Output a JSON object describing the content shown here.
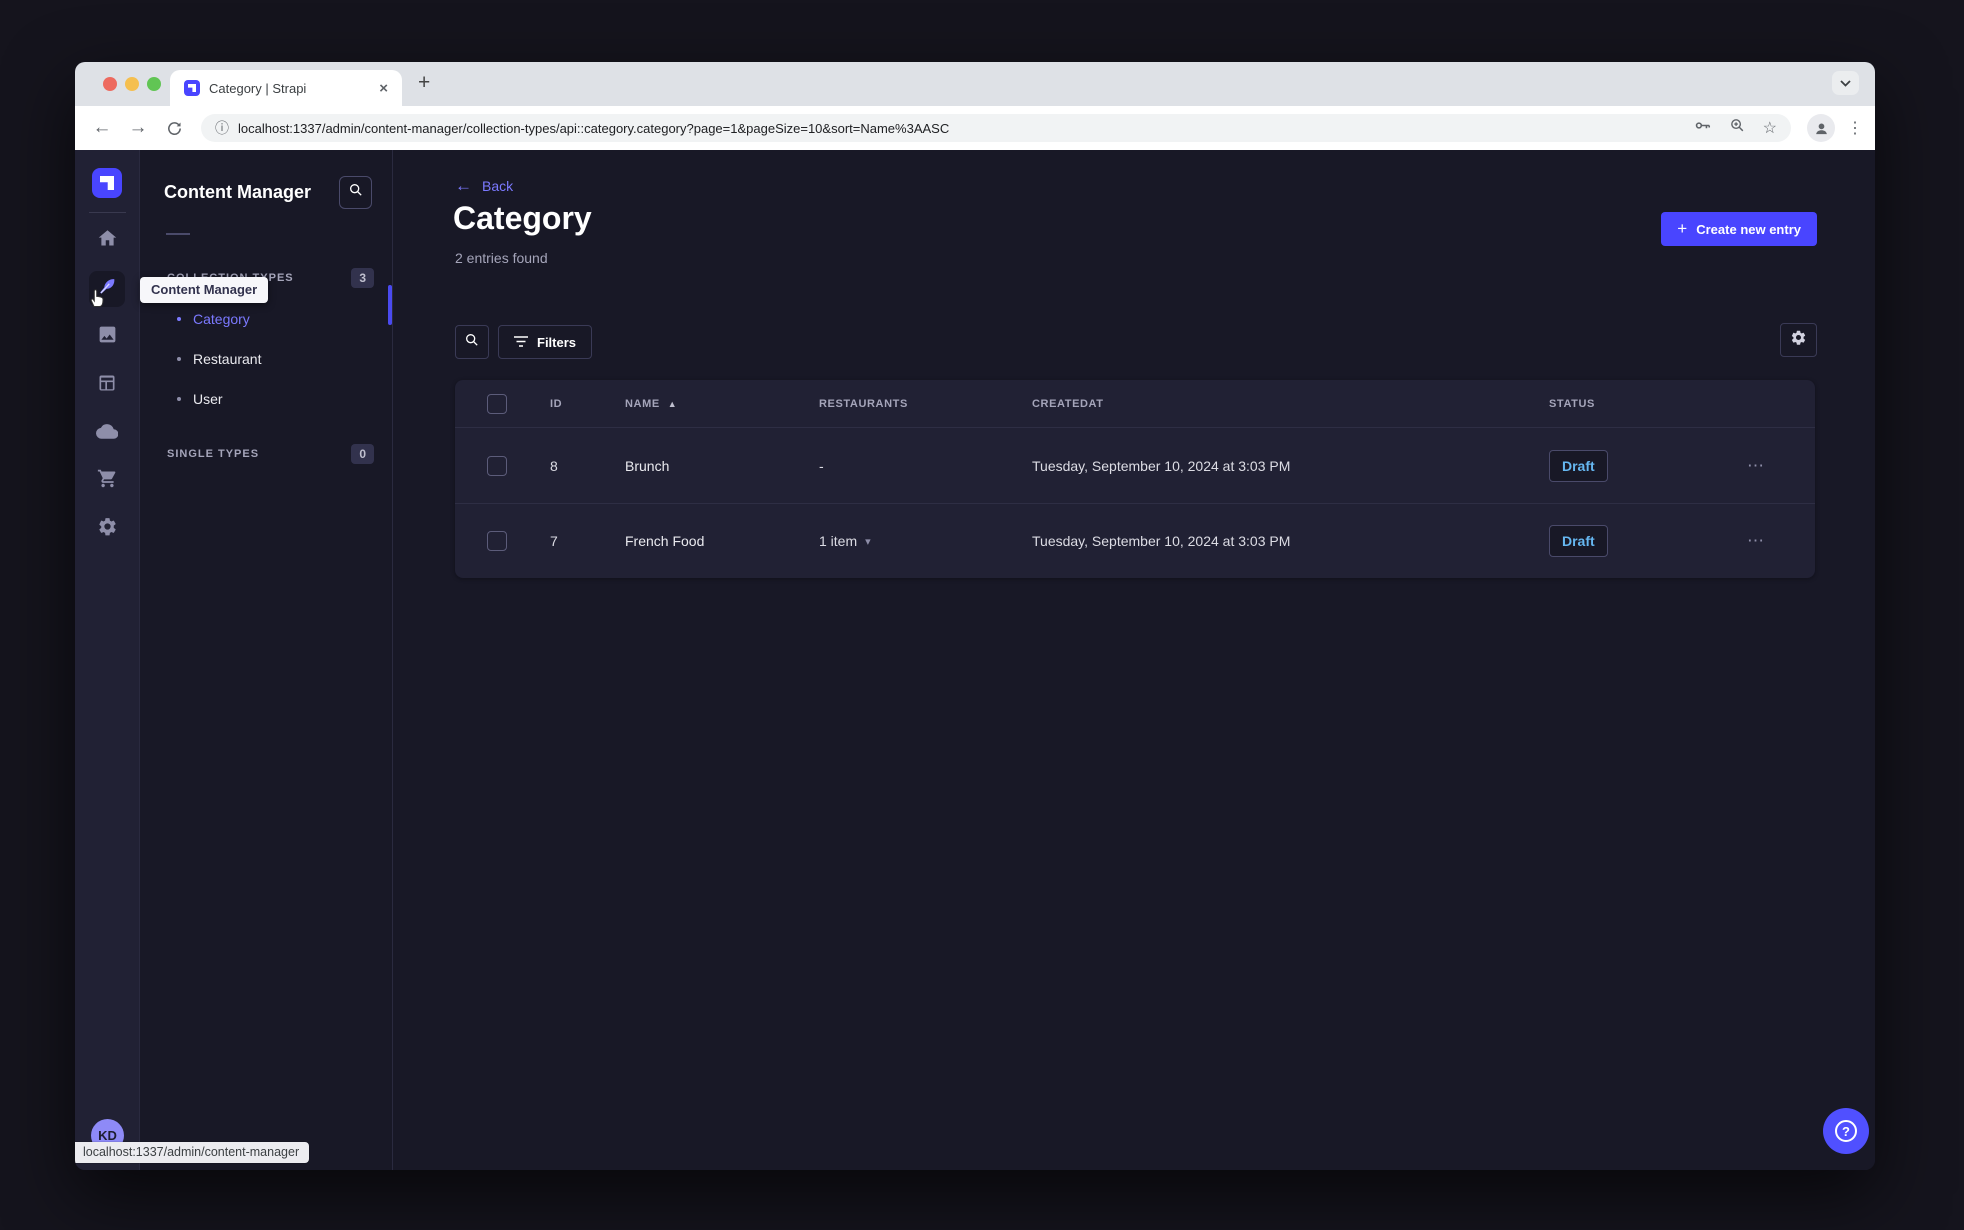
{
  "browser": {
    "tab_title": "Category | Strapi",
    "url": "localhost:1337/admin/content-manager/collection-types/api::category.category?page=1&pageSize=10&sort=Name%3AASC",
    "status_bar": "localhost:1337/admin/content-manager"
  },
  "icons": {
    "tab_close": "×",
    "new_tab": "+",
    "nav_back": "←",
    "nav_forward": "→",
    "url_info": "ⓘ",
    "bookmark_star": "☆",
    "kebab_vertical": "⋮",
    "row_actions": "⋯",
    "sort_asc": "▲",
    "caret_down": "▾",
    "plus": "+",
    "question": "?",
    "back_arrow": "←"
  },
  "sidebar": {
    "title": "Content Manager",
    "tooltip": "Content Manager",
    "sections": [
      {
        "label": "COLLECTION TYPES",
        "badge": "3"
      },
      {
        "label": "SINGLE TYPES",
        "badge": "0"
      }
    ],
    "items": [
      {
        "label": "Category"
      },
      {
        "label": "Restaurant"
      },
      {
        "label": "User"
      }
    ]
  },
  "header": {
    "back_label": "Back",
    "title": "Category",
    "subtitle": "2 entries found",
    "create_label": "Create new entry"
  },
  "filters": {
    "label": "Filters"
  },
  "table": {
    "columns": [
      "ID",
      "NAME",
      "RESTAURANTS",
      "CREATEDAT",
      "STATUS"
    ],
    "rows": [
      {
        "id": "8",
        "name": "Brunch",
        "restaurants": "-",
        "created_at": "Tuesday, September 10, 2024 at 3:03 PM",
        "status": "Draft"
      },
      {
        "id": "7",
        "name": "French Food",
        "restaurants": "1 item",
        "created_at": "Tuesday, September 10, 2024 at 3:03 PM",
        "status": "Draft"
      }
    ]
  },
  "user": {
    "initials": "KD"
  },
  "colors": {
    "primary": "#4945ff",
    "primary_light": "#7b79ff",
    "draft_text": "#66b7f1"
  }
}
